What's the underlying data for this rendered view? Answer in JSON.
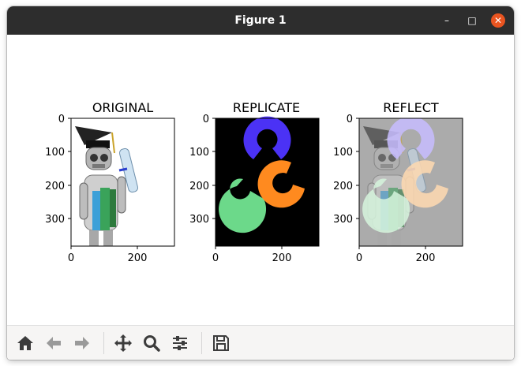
{
  "window": {
    "title": "Figure 1",
    "minimize_glyph": "–",
    "maximize_glyph": "□",
    "close_glyph": "✕"
  },
  "figure": {
    "panels": [
      {
        "title": "ORIGINAL",
        "yticks": [
          "0",
          "100",
          "200",
          "300"
        ],
        "xticks": [
          "0",
          "200"
        ],
        "content": "robot-graduate-image"
      },
      {
        "title": "REPLICATE",
        "yticks": [
          "0",
          "100",
          "200",
          "300"
        ],
        "xticks": [
          "0",
          "200"
        ],
        "content": "opencv-logo-image"
      },
      {
        "title": "REFLECT",
        "yticks": [
          "0",
          "100",
          "200",
          "300"
        ],
        "xticks": [
          "0",
          "200"
        ],
        "content": "blended-robot-logo-image"
      }
    ],
    "logo_colors": {
      "red_ring": "#4b32f5",
      "green_ring": "#6cd98a",
      "blue_ring": "#ff8a1f"
    }
  },
  "toolbar": {
    "buttons": [
      {
        "name": "home",
        "icon": "home-icon"
      },
      {
        "name": "back",
        "icon": "arrow-left-icon"
      },
      {
        "name": "forward",
        "icon": "arrow-right-icon"
      },
      {
        "name": "pan",
        "icon": "move-icon"
      },
      {
        "name": "zoom",
        "icon": "magnifier-icon"
      },
      {
        "name": "configure-subplots",
        "icon": "sliders-icon"
      },
      {
        "name": "save",
        "icon": "floppy-disk-icon"
      }
    ]
  }
}
